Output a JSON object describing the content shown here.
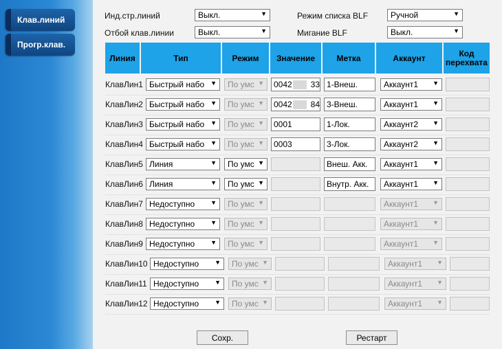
{
  "sidebar": {
    "items": [
      {
        "label": "Клав.линий"
      },
      {
        "label": "Прогр.клав."
      }
    ]
  },
  "settings": {
    "ind_label": "Инд.стр.линий",
    "ind_value": "Выкл.",
    "otboy_label": "Отбой клав.линии",
    "otboy_value": "Выкл.",
    "blf_mode_label": "Режим списка BLF",
    "blf_mode_value": "Ручной",
    "blf_blink_label": "Мигание BLF",
    "blf_blink_value": "Выкл."
  },
  "table": {
    "headers": [
      "Линия",
      "Тип",
      "Режим",
      "Значение",
      "Метка",
      "Аккаунт",
      "Код перехвата"
    ],
    "rows": [
      {
        "line": "КлавЛин1",
        "type": "Быстрый набо",
        "mode": "По умс",
        "value": "0042",
        "value_suffix": "33",
        "label": "1-Внеш.",
        "account": "Аккаунт1",
        "code": "",
        "enabled": "partial"
      },
      {
        "line": "КлавЛин2",
        "type": "Быстрый набо",
        "mode": "По умс",
        "value": "0042",
        "value_suffix": "84",
        "label": "3-Внеш.",
        "account": "Аккаунт1",
        "code": "",
        "enabled": "partial"
      },
      {
        "line": "КлавЛин3",
        "type": "Быстрый набо",
        "mode": "По умс",
        "value": "0001",
        "value_suffix": "",
        "label": "1-Лок.",
        "account": "Аккаунт2",
        "code": "",
        "enabled": "partial"
      },
      {
        "line": "КлавЛин4",
        "type": "Быстрый набо",
        "mode": "По умс",
        "value": "0003",
        "value_suffix": "",
        "label": "3-Лок.",
        "account": "Аккаунт2",
        "code": "",
        "enabled": "partial"
      },
      {
        "line": "КлавЛин5",
        "type": "Линия",
        "mode": "По умс",
        "value": "",
        "value_suffix": "",
        "label": "Внеш. Акк.",
        "account": "Аккаунт1",
        "code": "",
        "enabled": "line"
      },
      {
        "line": "КлавЛин6",
        "type": "Линия",
        "mode": "По умс",
        "value": "",
        "value_suffix": "",
        "label": "Внутр. Акк.",
        "account": "Аккаунт1",
        "code": "",
        "enabled": "line"
      },
      {
        "line": "КлавЛин7",
        "type": "Недоступно",
        "mode": "По умс",
        "value": "",
        "value_suffix": "",
        "label": "",
        "account": "Аккаунт1",
        "code": "",
        "enabled": "none"
      },
      {
        "line": "КлавЛин8",
        "type": "Недоступно",
        "mode": "По умс",
        "value": "",
        "value_suffix": "",
        "label": "",
        "account": "Аккаунт1",
        "code": "",
        "enabled": "none"
      },
      {
        "line": "КлавЛин9",
        "type": "Недоступно",
        "mode": "По умс",
        "value": "",
        "value_suffix": "",
        "label": "",
        "account": "Аккаунт1",
        "code": "",
        "enabled": "none"
      },
      {
        "line": "КлавЛин10",
        "type": "Недоступно",
        "mode": "По умс",
        "value": "",
        "value_suffix": "",
        "label": "",
        "account": "Аккаунт1",
        "code": "",
        "enabled": "none"
      },
      {
        "line": "КлавЛин11",
        "type": "Недоступно",
        "mode": "По умс",
        "value": "",
        "value_suffix": "",
        "label": "",
        "account": "Аккаунт1",
        "code": "",
        "enabled": "none"
      },
      {
        "line": "КлавЛин12",
        "type": "Недоступно",
        "mode": "По умс",
        "value": "",
        "value_suffix": "",
        "label": "",
        "account": "Аккаунт1",
        "code": "",
        "enabled": "none"
      }
    ]
  },
  "buttons": {
    "save": "Сохр.",
    "restart": "Рестарт"
  },
  "icons": {
    "dropdown": "chevron-down-icon"
  },
  "colors": {
    "header": "#1ea3e8",
    "sidebar": "#2c88d4",
    "sidebar_button": "#0f4582"
  }
}
